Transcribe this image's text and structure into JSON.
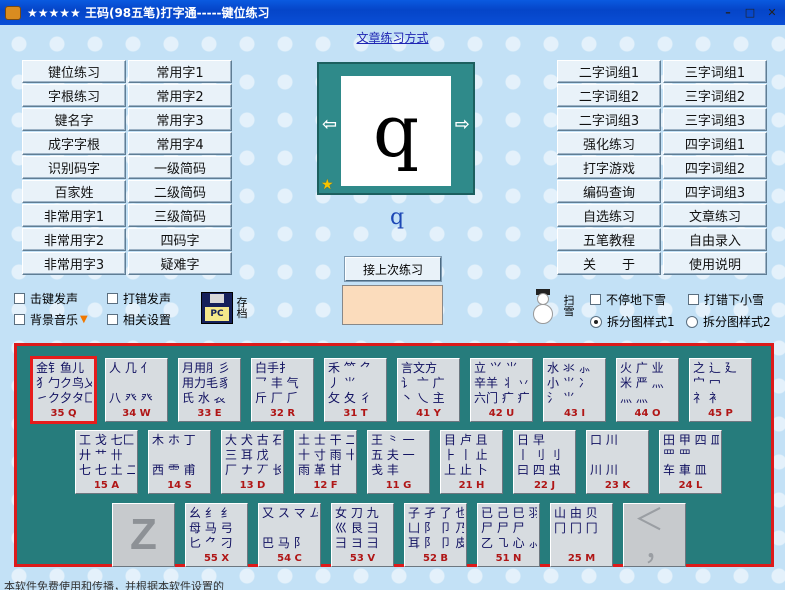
{
  "window": {
    "title": "★★★★★ 王码(98五笔)打字通-----键位练习",
    "minimize": "–",
    "maximize": "□",
    "close": "✕"
  },
  "top_link": "文章练习方式",
  "left_buttons": [
    "键位练习",
    "常用字1",
    "字根练习",
    "常用字2",
    "键名字",
    "常用字3",
    "成字字根",
    "常用字4",
    "识别码字",
    "一级简码",
    "百家姓",
    "二级简码",
    "非常用字1",
    "三级简码",
    "非常用字2",
    "四码字",
    "非常用字3",
    "疑难字"
  ],
  "right_buttons": [
    "二字词组1",
    "三字词组1",
    "二字词组2",
    "三字词组2",
    "二字词组3",
    "三字词组3",
    "强化练习",
    "四字词组1",
    "打字游戏",
    "四字词组2",
    "编码查询",
    "四字词组3",
    "自选练习",
    "文章练习",
    "五笔教程",
    "自由录入",
    "关　　于",
    "使用说明"
  ],
  "display": {
    "card_char": "q",
    "left_arrow": "⇦",
    "right_arrow": "⇨",
    "star": "★",
    "shown_key": "q"
  },
  "resume_button": "接上次练习",
  "options": {
    "key_sound": "击键发声",
    "error_sound": "打错发声",
    "bg_music": "背景音乐",
    "settings": "相关设置",
    "save_label": "存档",
    "floppy_label": "PC",
    "snow_label": "扫雪",
    "snow_nonstop": "不停地下雪",
    "snow_error": "打错下小雪",
    "style1": "拆分图样式1",
    "style2": "拆分图样式2"
  },
  "keys": [
    {
      "roots": "金钅鱼儿\n犭勹ク鸟乂\n㇀ク夕タ匚",
      "code": "35 Q"
    },
    {
      "roots": "人 几 亻\n\n八 癶 癶",
      "code": "34 W"
    },
    {
      "roots": "月用⺼彡\n用力毛豸\n氏 水 𧘇",
      "code": "33 E"
    },
    {
      "roots": "白手扌\n乛 丰 气\n斤 厂 ⺁",
      "code": "32 R"
    },
    {
      "roots": "禾 ⺮ ⺈\n丿 ⺌\n攵 夂 彳",
      "code": "31 T"
    },
    {
      "roots": "言文方\n讠 亠 广\n丶 乀 主",
      "code": "41 Y"
    },
    {
      "roots": "立 ⺍ ⺌\n辛羊 丬 丷\n六门 疒 疒",
      "code": "42 U"
    },
    {
      "roots": "水 氺 ⺗\n小 ⺌ 冫\n氵 ⺌",
      "code": "43 I"
    },
    {
      "roots": "火 广 业\n米 严 灬\n灬 灬",
      "code": "44 O"
    },
    {
      "roots": "之 辶 廴\n宀 冖\n礻 衤",
      "code": "45 P"
    },
    {
      "roots": "工 戈 七匚\n廾 艹 卄\n七 七 土 二",
      "code": "15 A"
    },
    {
      "roots": "木 ホ 丁\n\n西 ⻗ 甫",
      "code": "14 S"
    },
    {
      "roots": "大 犬 古 石\n三 耳 戊\n厂 ナ 丆 长",
      "code": "13 D"
    },
    {
      "roots": "土 士 干 二\n十 寸 雨 十\n雨 革 甘",
      "code": "12 F"
    },
    {
      "roots": "王 ⺀ 一\n五 夫 一\n戋 丰",
      "code": "11 G"
    },
    {
      "roots": "目 卢 且\n⺊ 丨 止\n上 止 卜",
      "code": "21 H"
    },
    {
      "roots": "日 早\n丨 刂 刂\n曰 四 虫",
      "code": "22 J"
    },
    {
      "roots": "口 川\n\n川 川",
      "code": "23 K"
    },
    {
      "roots": "田 甲 四 皿\n罒 罒\n车 車 皿",
      "code": "24 L"
    },
    {
      "roots": "",
      "code": "",
      "blank": "Z"
    },
    {
      "roots": "幺 纟 纟\n母 马 弓\n匕 ⺈ 刁",
      "code": "55 X"
    },
    {
      "roots": "又 ス マ ム\n\n巴 马 阝",
      "code": "54 C"
    },
    {
      "roots": "女 刀 九\n巛 艮 ⺕\n彐 ヨ 彐",
      "code": "53 V"
    },
    {
      "roots": "子 孑 了 也\n凵 阝 卩 乃\n耳 阝 卩 皮",
      "code": "52 B"
    },
    {
      "roots": "已 己 巳 羽\n尸 尸 尸\n乙 ㇈ 心 ⺗",
      "code": "51 N"
    },
    {
      "roots": "山 由 贝\n冂 冂 冂",
      "code": "25 M"
    },
    {
      "roots": "",
      "code": "",
      "blank": "＜\n ，"
    }
  ],
  "status_text": "本软件免费使用和传播，并根据本软件设置的"
}
